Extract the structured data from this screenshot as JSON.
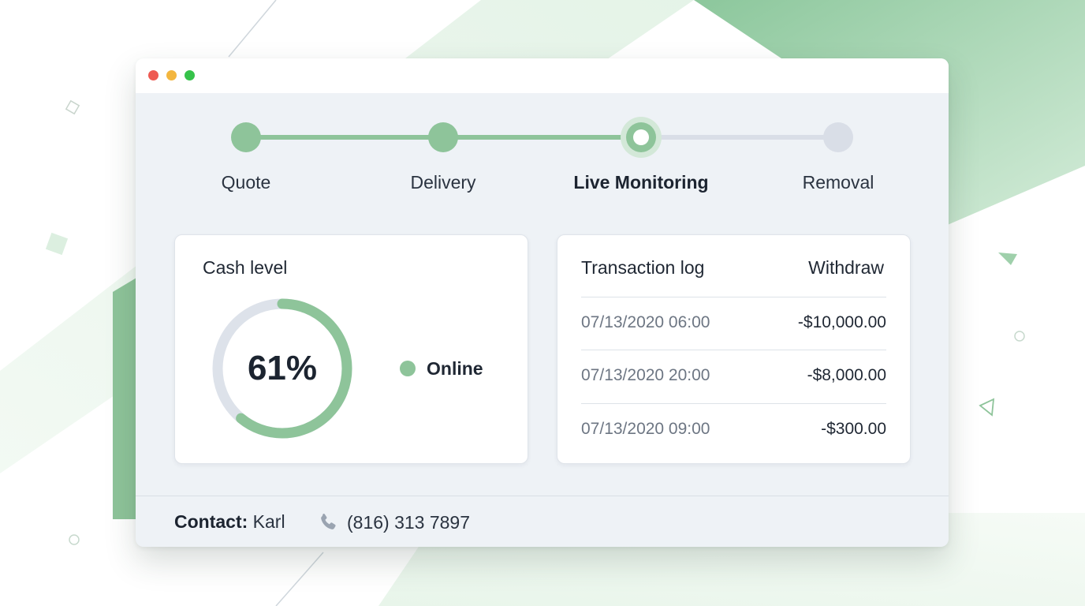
{
  "window": {
    "controls": [
      "close",
      "minimize",
      "zoom"
    ]
  },
  "stepper": {
    "steps": [
      {
        "label": "Quote",
        "state": "done"
      },
      {
        "label": "Delivery",
        "state": "done"
      },
      {
        "label": "Live Monitoring",
        "state": "current"
      },
      {
        "label": "Removal",
        "state": "todo"
      }
    ]
  },
  "cash_card": {
    "title": "Cash level",
    "level_percent": 61,
    "level_text": "61%",
    "status": "Online"
  },
  "log_card": {
    "title": "Transaction log",
    "column": "Withdraw",
    "rows": [
      {
        "when": "07/13/2020 06:00",
        "amount": "-$10,000.00"
      },
      {
        "when": "07/13/2020 20:00",
        "amount": "-$8,000.00"
      },
      {
        "when": "07/13/2020 09:00",
        "amount": "-$300.00"
      }
    ]
  },
  "footer": {
    "contact_key": "Contact:",
    "contact_name": "Karl",
    "phone_icon": "phone-icon",
    "phone": "(816) 313 7897"
  },
  "colors": {
    "accent": "#8ec49a",
    "track": "#d9dee7",
    "panel": "#eef2f6"
  }
}
